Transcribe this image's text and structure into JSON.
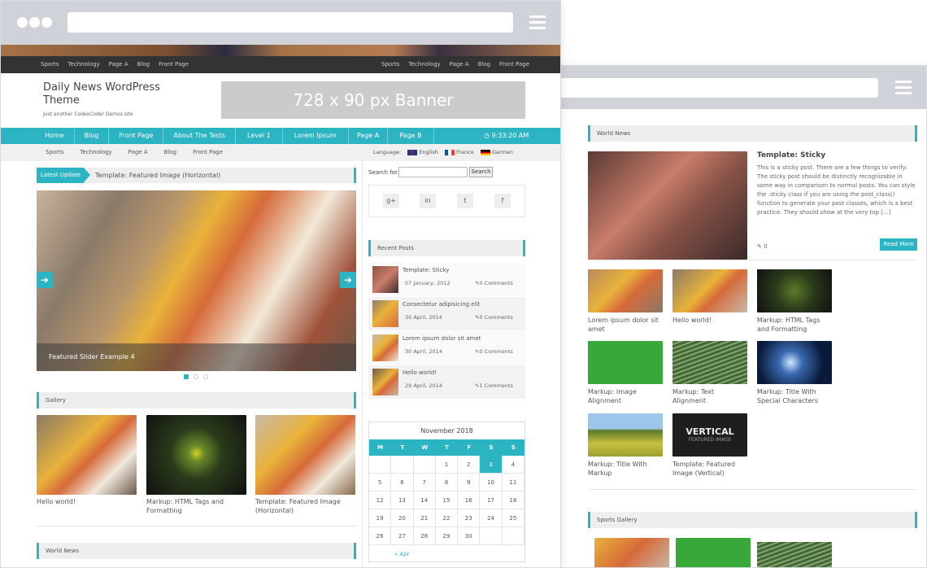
{
  "front": {
    "topnav_left": [
      "Sports",
      "Technology",
      "Page A",
      "Blog",
      "Front Page"
    ],
    "topnav_right": [
      "Sports",
      "Technology",
      "Page A",
      "Blog",
      "Front Page"
    ],
    "site_title": "Daily News WordPress Theme",
    "site_tagline": "Just another CodexCoder Demos site",
    "banner_text": "728 x 90 px Banner",
    "mainnav": [
      "Home",
      "Blog",
      "Front Page",
      "About The Tests",
      "Level 1",
      "Lorem Ipsum",
      "Page A",
      "Page B"
    ],
    "time": "9:33:20 AM",
    "subnav": [
      "Sports",
      "Technology",
      "Page A",
      "Blog",
      "Front Page"
    ],
    "language_label": "Language:",
    "languages": [
      "English",
      "France",
      "Garman"
    ],
    "latest_update_label": "Latest Update",
    "latest_update_text": "Template: Featured Image (Horizontal)",
    "slider_caption": "Featured Slider Example 4",
    "gallery_title": "Gallery",
    "gallery": [
      "Hello world!",
      "Markup: HTML Tags and Formatting",
      "Template: Featured Image (Horizontal)"
    ],
    "world_news_title": "World News",
    "search_label": "Search for:",
    "search_button": "Search",
    "recent_posts_title": "Recent Posts",
    "recent_posts": [
      {
        "title": "Template: Sticky",
        "date": "07 January, 2012",
        "comments": "0 Comments"
      },
      {
        "title": "Consectetur adipisicing elit",
        "date": "30 April, 2014",
        "comments": "0 Comments"
      },
      {
        "title": "Lorem ipsum dolor sit amet",
        "date": "30 April, 2014",
        "comments": "0 Comments"
      },
      {
        "title": "Hello world!",
        "date": "29 April, 2014",
        "comments": "1 Comments"
      }
    ],
    "calendar": {
      "month": "November 2018",
      "days": [
        "M",
        "T",
        "W",
        "T",
        "F",
        "S",
        "S"
      ],
      "rows": [
        [
          "",
          "",
          "",
          "1",
          "2",
          "3",
          "4"
        ],
        [
          "5",
          "6",
          "7",
          "8",
          "9",
          "10",
          "11"
        ],
        [
          "12",
          "13",
          "14",
          "15",
          "16",
          "17",
          "18"
        ],
        [
          "19",
          "20",
          "21",
          "22",
          "23",
          "24",
          "25"
        ],
        [
          "26",
          "27",
          "28",
          "29",
          "30",
          "",
          ""
        ]
      ],
      "prev": "« Apr"
    }
  },
  "back": {
    "world_news_title": "World News",
    "sticky_title": "Template: Sticky",
    "sticky_text": "This is a sticky post. There are a few things to verify: The sticky post should be distinctly recognizable in some way in comparison to normal posts. You can style the .sticky class if you are using the post_class() function to generate your post classes, which is a best practice. They should show at the very top […]",
    "comments_count": "0",
    "read_more": "Read More",
    "grid": [
      "Lorem ipsum dolor sit amet",
      "Hello world!",
      "Markup: HTML Tags and Formatting",
      "Markup: Image Alignment",
      "Markup: Text Alignment",
      "Markup: Title With Special Characters",
      "Markup: Title With Markup",
      "Template: Featured Image (Vertical)"
    ],
    "vertical_big": "VERTICAL",
    "vertical_small": "FEATURED IMAGE",
    "sports_gallery_title": "Sports Gallery"
  }
}
